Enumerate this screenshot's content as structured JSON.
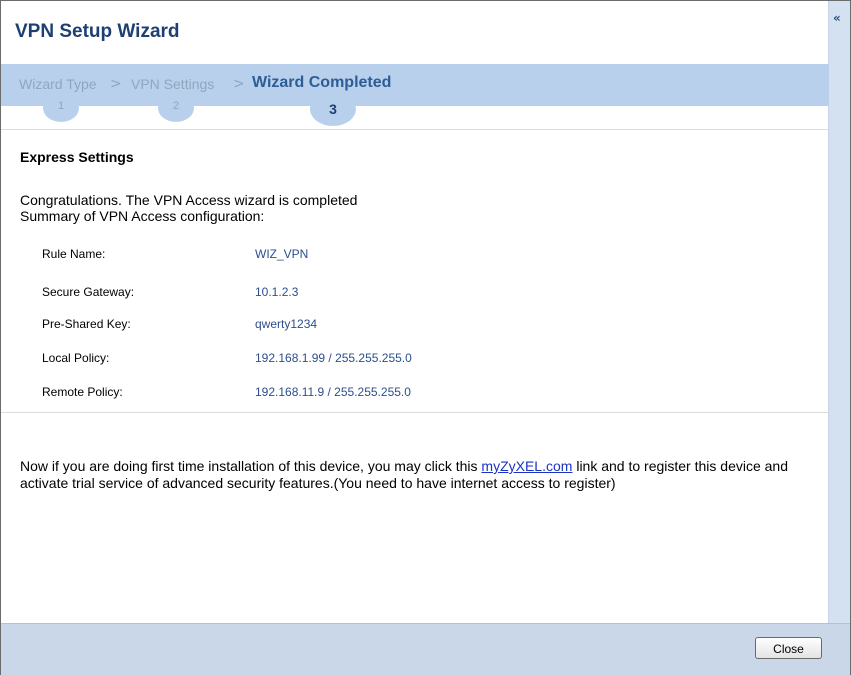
{
  "window": {
    "title": "VPN Setup Wizard"
  },
  "steps": [
    {
      "label": "Wizard Type",
      "number": "1",
      "active": false
    },
    {
      "label": "VPN Settings",
      "number": "2",
      "active": false
    },
    {
      "label": "Wizard Completed",
      "number": "3",
      "active": true
    }
  ],
  "step_separator": ">",
  "content": {
    "section_title": "Express Settings",
    "line1": "Congratulations. The VPN Access wizard is completed",
    "line2": "Summary of VPN Access configuration:",
    "summary": [
      {
        "label": "Rule Name:",
        "value": "WIZ_VPN"
      },
      {
        "label": "Secure Gateway:",
        "value": "10.1.2.3"
      },
      {
        "label": "Pre-Shared Key:",
        "value": "qwerty1234"
      },
      {
        "label": "Local Policy:",
        "value": "192.168.1.99 / 255.255.255.0"
      },
      {
        "label": "Remote Policy:",
        "value": "192.168.11.9 / 255.255.255.0"
      }
    ],
    "note_before": "Now if you are doing first time installation of this device, you may click this ",
    "note_link": "myZyXEL.com",
    "note_after": " link and to register this device and activate trial service of advanced security features.(You need to have internet access to register)"
  },
  "footer": {
    "close_label": "Close"
  },
  "icons": {
    "collapse": "double-chevron-left-icon"
  },
  "colors": {
    "title": "#1f3f73",
    "band": "#b9d0ec",
    "value": "#2b4f8c",
    "link": "#1a33c4",
    "footer": "#c9d7e8"
  }
}
